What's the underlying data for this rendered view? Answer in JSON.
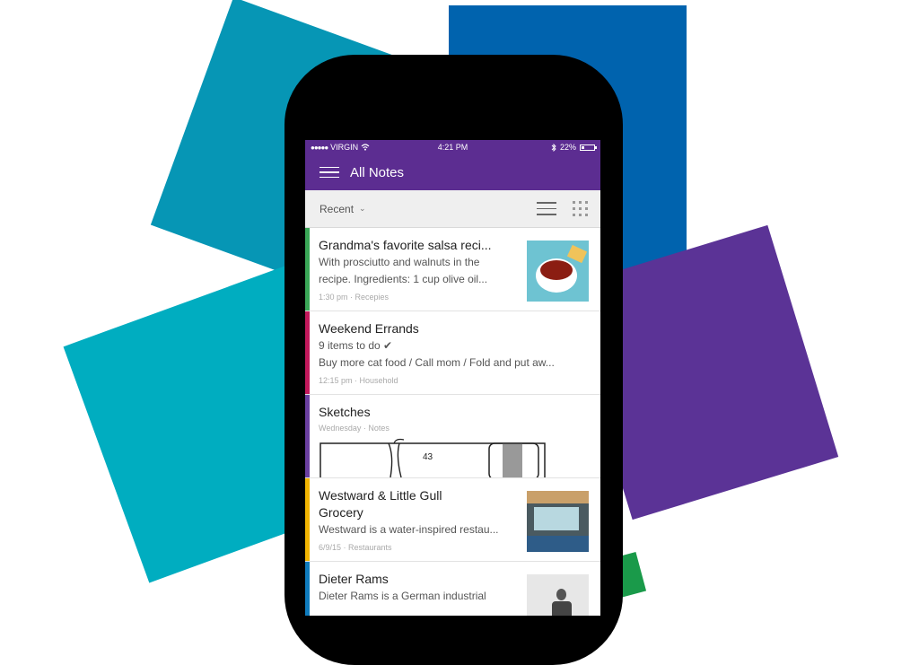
{
  "status_bar": {
    "signal": "●●●●●",
    "carrier": "VIRGIN",
    "wifi_icon": "wifi-icon",
    "time": "4:21 PM",
    "bluetooth_icon": "bluetooth-icon",
    "battery": "22%",
    "battery_level": 0.22
  },
  "app_bar": {
    "menu_icon": "hamburger-menu-icon",
    "title": "All Notes"
  },
  "toolbar": {
    "sort_label": "Recent",
    "sort_icon": "chevron-down-icon",
    "list_view_icon": "list-view-icon",
    "grid_view_icon": "grid-view-icon"
  },
  "notes": [
    {
      "title": "Grandma's favorite salsa reci...",
      "body_lines": [
        "With prosciutto and walnuts in the",
        "recipe.  Ingredients: 1 cup olive oil..."
      ],
      "meta": "1:30 pm · Recepies",
      "color": "#3aa757",
      "thumbnail": "salsa-bowl-image"
    },
    {
      "title": "Weekend Errands",
      "body_lines": [
        "9 items to do ✔",
        "Buy more cat food / Call mom / Fold and put aw..."
      ],
      "meta": "12:15 pm · Household",
      "color": "#c2185b"
    },
    {
      "title": "Sketches",
      "meta": "Wednesday · Notes",
      "sketch_label": "43",
      "color": "#6a3fa0"
    },
    {
      "title_lines": [
        "Westward & Little Gull",
        "Grocery"
      ],
      "body_lines": [
        "Westward is a water-inspired restau..."
      ],
      "meta": "6/9/15 · Restaurants",
      "color": "#f0b400",
      "thumbnail": "restaurant-interior-image"
    },
    {
      "title": "Dieter Rams",
      "body_lines": [
        "Dieter Rams is a German industrial"
      ],
      "color": "#0f7bbd",
      "thumbnail": "dieter-rams-photo"
    }
  ]
}
